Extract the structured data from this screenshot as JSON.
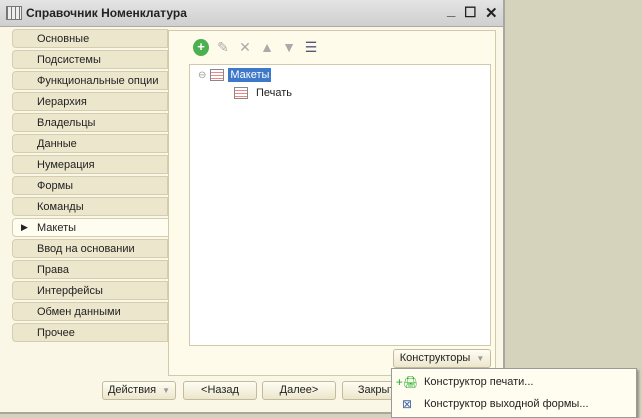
{
  "window": {
    "title": "Справочник Номенклатура",
    "minimize": "_",
    "maximize": "☐",
    "close": "✕"
  },
  "tabs": [
    {
      "label": "Основные"
    },
    {
      "label": "Подсистемы"
    },
    {
      "label": "Функциональные опции"
    },
    {
      "label": "Иерархия"
    },
    {
      "label": "Владельцы"
    },
    {
      "label": "Данные"
    },
    {
      "label": "Нумерация"
    },
    {
      "label": "Формы"
    },
    {
      "label": "Команды"
    },
    {
      "label": "Макеты",
      "selected": true
    },
    {
      "label": "Ввод на основании"
    },
    {
      "label": "Права"
    },
    {
      "label": "Интерфейсы"
    },
    {
      "label": "Обмен данными"
    },
    {
      "label": "Прочее"
    }
  ],
  "toolbar": {
    "icons": [
      "add-icon",
      "edit-icon",
      "delete-icon",
      "move-up-icon",
      "move-down-icon",
      "sort-icon"
    ]
  },
  "tree": {
    "root": "Макеты",
    "children": [
      "Печать"
    ]
  },
  "buttons": {
    "constructors": "Конструкторы",
    "actions": "Действия",
    "back": "<Назад",
    "next": "Далее>",
    "close": "Закрыть"
  },
  "menu": {
    "items": [
      {
        "label": "Конструктор печати..."
      },
      {
        "label": "Конструктор выходной формы..."
      }
    ]
  }
}
